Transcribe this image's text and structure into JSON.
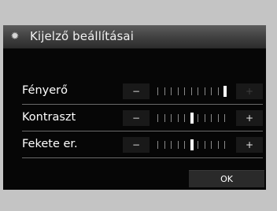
{
  "dialog": {
    "title": "Kijelző beállításai",
    "icon": "gear-icon"
  },
  "settings": [
    {
      "label": "Fényerő",
      "minus": "−",
      "plus": "+",
      "ticks": 11,
      "level": 11,
      "plus_enabled": false
    },
    {
      "label": "Kontraszt",
      "minus": "−",
      "plus": "+",
      "ticks": 11,
      "level": 6,
      "plus_enabled": true
    },
    {
      "label": "Fekete er.",
      "minus": "−",
      "plus": "+",
      "ticks": 11,
      "level": 6,
      "plus_enabled": true
    }
  ],
  "ok_label": "OK",
  "colors": {
    "background": "#c4c4c4",
    "screen": "#060606",
    "text": "#ffffff"
  }
}
